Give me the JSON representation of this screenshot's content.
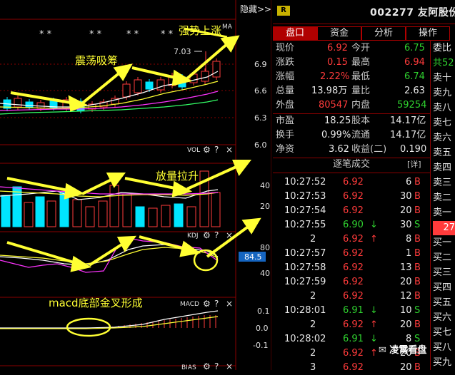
{
  "chart": {
    "hide_button": "隐藏>>",
    "stars": [
      "* *",
      "* *",
      "* *",
      "* *"
    ],
    "price_label_high": "7.03",
    "ma_label": "MA",
    "price_ticks": [
      "6.9",
      "6.6",
      "6.3",
      "6.0"
    ],
    "vol_label": "VOL",
    "vol_ticks": [
      "40",
      "20"
    ],
    "kdj_label": "KDJ",
    "kdj_ticks": [
      "80",
      "40"
    ],
    "kdj_value": "84.5",
    "macd_label": "MACD",
    "macd_ticks": [
      "0.1",
      "0.0",
      "-0.1"
    ],
    "bias_label": "BIAS",
    "annot_shock": "震荡吸筹",
    "annot_strong": "强势上涨",
    "annot_volume": "放量拉升",
    "annot_macd": "macd底部金叉形成",
    "colors": {
      "up": "#ff3b3b",
      "down": "#00e5ff",
      "arrow": "#ffff33",
      "grid": "#8a0000"
    }
  },
  "header": {
    "badge": "R",
    "code_name": "002277 友阿股份"
  },
  "tabs": [
    {
      "label": "盘口",
      "active": true
    },
    {
      "label": "资金",
      "active": false
    },
    {
      "label": "分析",
      "active": false
    },
    {
      "label": "操作",
      "active": false
    }
  ],
  "quote": {
    "now_label": "现价",
    "now": "6.92",
    "open_label": "今开",
    "open": "6.75",
    "chg_label": "涨跌",
    "chg": "0.15",
    "high_label": "最高",
    "high": "6.94",
    "pct_label": "涨幅",
    "pct": "2.22%",
    "low_label": "最低",
    "low": "6.74",
    "vol_label": "总量",
    "vol": "13.98万",
    "vr_label": "量比",
    "vr": "2.63",
    "out_label": "外盘",
    "out": "80547",
    "in_label": "内盘",
    "in": "59254",
    "pe_label": "市盈",
    "pe": "18.25",
    "share_label": "股本",
    "share": "14.17亿",
    "turn_label": "换手",
    "turn": "0.99%",
    "float_label": "流通",
    "float": "14.17亿",
    "nav_label": "净资",
    "nav": "3.62",
    "eps_label": "收益(二)",
    "eps": "0.190"
  },
  "trades_header": {
    "title": "逐笔成交",
    "detail": "[详]"
  },
  "trades": [
    {
      "time": "10:27:52",
      "price": "6.92",
      "arrow": "",
      "vol": "6",
      "side": "B"
    },
    {
      "time": "10:27:53",
      "price": "6.92",
      "arrow": "",
      "vol": "30",
      "side": "B"
    },
    {
      "time": "10:27:54",
      "price": "6.92",
      "arrow": "",
      "vol": "20",
      "side": "B"
    },
    {
      "time": "10:27:55",
      "price": "6.90",
      "arrow": "↓",
      "vol": "30",
      "side": "S"
    },
    {
      "time": "2",
      "price": "6.92",
      "arrow": "↑",
      "vol": "8",
      "side": "B"
    },
    {
      "time": "10:27:57",
      "price": "6.92",
      "arrow": "",
      "vol": "1",
      "side": "B"
    },
    {
      "time": "10:27:58",
      "price": "6.92",
      "arrow": "",
      "vol": "13",
      "side": "B"
    },
    {
      "time": "10:27:59",
      "price": "6.92",
      "arrow": "",
      "vol": "20",
      "side": "B"
    },
    {
      "time": "2",
      "price": "6.92",
      "arrow": "",
      "vol": "12",
      "side": "B"
    },
    {
      "time": "10:28:01",
      "price": "6.91",
      "arrow": "↓",
      "vol": "10",
      "side": "S"
    },
    {
      "time": "2",
      "price": "6.92",
      "arrow": "↑",
      "vol": "20",
      "side": "B"
    },
    {
      "time": "10:28:02",
      "price": "6.91",
      "arrow": "↓",
      "vol": "8",
      "side": "S"
    },
    {
      "time": "2",
      "price": "6.92",
      "arrow": "↑",
      "vol": "20",
      "side": "B"
    },
    {
      "time": "3",
      "price": "6.92",
      "arrow": "",
      "vol": "20",
      "side": "B"
    }
  ],
  "orderbook": [
    "委比",
    "共52",
    "卖十",
    "卖九",
    "卖八",
    "卖七",
    "卖六",
    "卖五",
    "卖四",
    "卖三",
    "卖二",
    "卖一",
    "27",
    "买一",
    "买二",
    "买三",
    "买四",
    "买五",
    "买六",
    "买七",
    "买八",
    "买九"
  ],
  "watermark": "凌霄看盘"
}
